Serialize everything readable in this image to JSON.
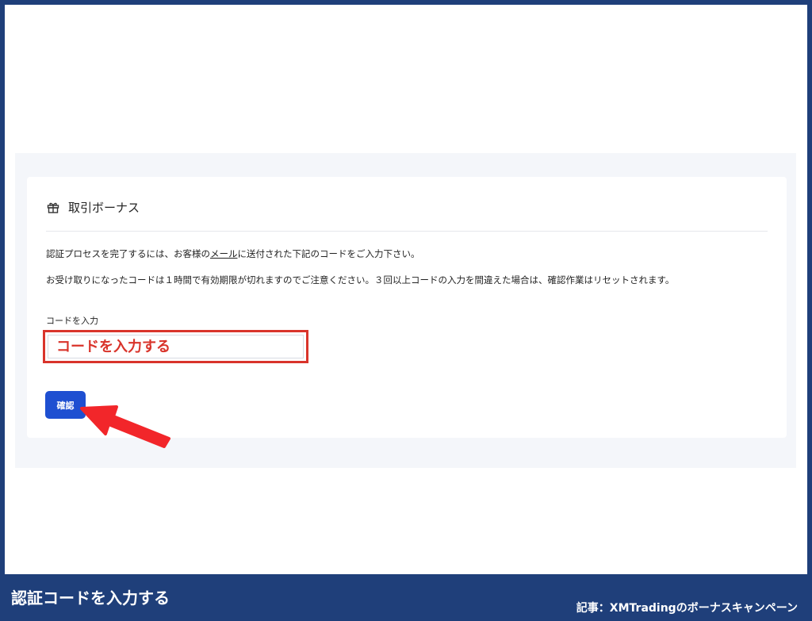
{
  "card": {
    "title": "取引ボーナス",
    "icon": "gift-icon",
    "line1_prefix": "認証プロセスを完了するには、お客様の",
    "line1_link": "メール",
    "line1_suffix": "に送付された下記のコードをご入力下さい。",
    "line2": "お受け取りになったコードは１時間で有効期限が切れますのでご注意ください。３回以上コードの入力を間違えた場合は、確認作業はリセットされます。"
  },
  "form": {
    "code_label": "コードを入力",
    "code_placeholder": "コードを入力する",
    "confirm_label": "確認"
  },
  "caption": {
    "main": "認証コードを入力する",
    "sub": "記事：XMTradingのボーナスキャンペーン"
  },
  "colors": {
    "frame": "#1f3f7a",
    "accent_red": "#d9342b",
    "button_blue": "#1e4fd1"
  }
}
